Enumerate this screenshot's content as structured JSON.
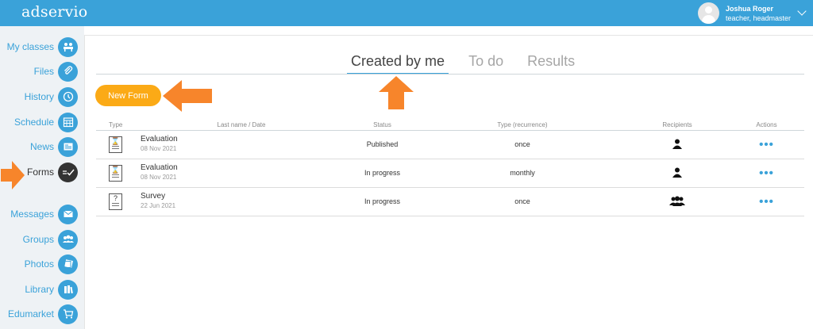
{
  "brand": {
    "logo": "adservio",
    "accent": "#3aa2d9",
    "button_color": "#fbaa16",
    "arrow_color": "#f7852b"
  },
  "user": {
    "name": "Joshua Roger",
    "role": "teacher, headmaster"
  },
  "sidebar": {
    "items": [
      {
        "label": "My classes",
        "icon": "classroom-icon"
      },
      {
        "label": "Files",
        "icon": "paperclip-icon"
      },
      {
        "label": "History",
        "icon": "history-icon"
      },
      {
        "label": "Schedule",
        "icon": "calendar-icon"
      },
      {
        "label": "News",
        "icon": "news-icon"
      },
      {
        "label": "Forms",
        "icon": "forms-icon",
        "active": true
      },
      {
        "label": "Messages",
        "icon": "envelope-icon"
      },
      {
        "label": "Groups",
        "icon": "groups-icon"
      },
      {
        "label": "Photos",
        "icon": "photos-icon"
      },
      {
        "label": "Library",
        "icon": "library-icon"
      },
      {
        "label": "Edumarket",
        "icon": "cart-icon"
      }
    ]
  },
  "tabs": [
    {
      "label": "Created by me",
      "active": true
    },
    {
      "label": "To do"
    },
    {
      "label": "Results"
    }
  ],
  "new_form_label": "New Form",
  "table": {
    "headers": [
      "Type",
      "Last name / Date",
      "Status",
      "Type (recurrence)",
      "Recipients",
      "Actions"
    ],
    "rows": [
      {
        "type_icon": "evaluation-form-icon",
        "name": "Evaluation",
        "date": "08 Nov 2021",
        "status": "Published",
        "recurrence": "once",
        "recipients_icon": "single-person-icon"
      },
      {
        "type_icon": "evaluation-form-icon",
        "name": "Evaluation",
        "date": "08 Nov 2021",
        "status": "In progress",
        "recurrence": "monthly",
        "recipients_icon": "single-person-icon"
      },
      {
        "type_icon": "survey-form-icon",
        "name": "Survey",
        "date": "22 Jun 2021",
        "status": "In progress",
        "recurrence": "once",
        "recipients_icon": "group-people-icon"
      }
    ]
  }
}
